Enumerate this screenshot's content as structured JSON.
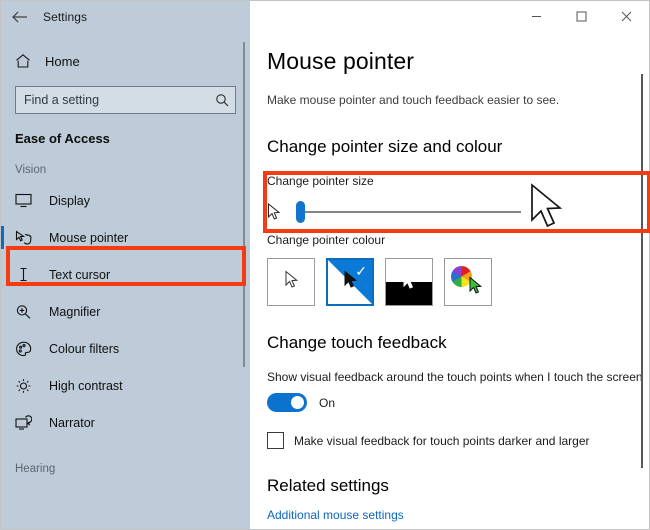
{
  "window": {
    "titlebar": {
      "back_icon": "back-arrow-icon",
      "title": "Settings",
      "minimize_label": "─",
      "maximize_label": "☐",
      "close_label": "✕"
    }
  },
  "sidebar": {
    "home": {
      "icon": "home-icon",
      "label": "Home"
    },
    "search": {
      "icon": "search-icon",
      "placeholder": "Find a setting",
      "value": ""
    },
    "category": "Ease of Access",
    "groups": [
      {
        "label": "Vision",
        "items": [
          {
            "icon": "display-monitor-icon",
            "label": "Display",
            "selected": false
          },
          {
            "icon": "mouse-pointer-icon",
            "label": "Mouse pointer",
            "selected": true
          },
          {
            "icon": "text-cursor-icon",
            "label": "Text cursor",
            "selected": false
          },
          {
            "icon": "magnifier-icon",
            "label": "Magnifier",
            "selected": false
          },
          {
            "icon": "colour-palette-icon",
            "label": "Colour filters",
            "selected": false
          },
          {
            "icon": "sun-contrast-icon",
            "label": "High contrast",
            "selected": false
          },
          {
            "icon": "narrator-icon",
            "label": "Narrator",
            "selected": false
          }
        ]
      },
      {
        "label": "Hearing",
        "items": []
      }
    ]
  },
  "main": {
    "heading": "Mouse pointer",
    "subtitle": "Make mouse pointer and touch feedback easier to see.",
    "sections": {
      "pointer": {
        "heading": "Change pointer size and colour",
        "size_label": "Change pointer size",
        "slider": {
          "min": 1,
          "max": 15,
          "value": 1,
          "percent": 0
        },
        "colour_label": "Change pointer colour",
        "swatches": [
          {
            "name": "white-pointer-swatch",
            "selected": false
          },
          {
            "name": "black-pointer-swatch",
            "selected": true
          },
          {
            "name": "inverted-pointer-swatch",
            "selected": false
          },
          {
            "name": "custom-colour-pointer-swatch",
            "selected": false
          }
        ]
      },
      "touch": {
        "heading": "Change touch feedback",
        "toggle_description": "Show visual feedback around the touch points when I touch the screen",
        "toggle_state": "On",
        "toggle_on": true,
        "checkbox_label": "Make visual feedback for touch points darker and larger",
        "checkbox_checked": false
      },
      "related": {
        "heading": "Related settings",
        "link": "Additional mouse settings"
      }
    }
  },
  "colors": {
    "sidebar_bg": "#bdccd8",
    "accent_blue": "#0b6ebd",
    "highlight_red": "#f43b12",
    "link_blue": "#0a66c0"
  }
}
